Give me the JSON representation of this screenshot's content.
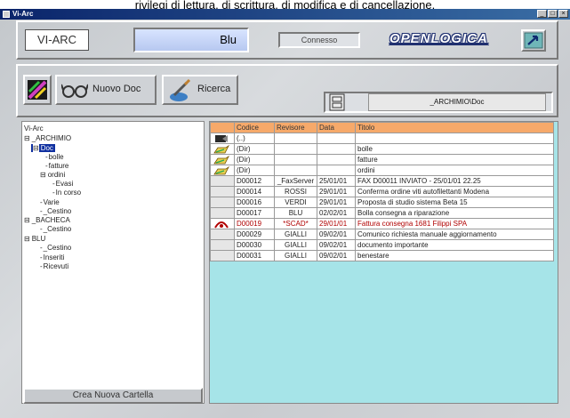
{
  "caption": "rivilegi di lettura, di scrittura, di modifica e di cancellazione.",
  "window": {
    "title": "Vi-Arc",
    "controls": [
      "_",
      "□",
      "×"
    ]
  },
  "header": {
    "archive_label": "VI-ARC",
    "user_label": "Blu",
    "status_label": "Connesso",
    "brand": "OPENLOGICA",
    "exit_icon": "exit-arrow-icon"
  },
  "toolbar": {
    "view_icon": "colors-icon",
    "new_doc_label": "Nuovo Doc",
    "new_doc_icon": "glasses-icon",
    "search_label": "Ricerca",
    "search_icon": "brush-icon",
    "archive_path_icon": "cabinet-icon",
    "archive_path": "_ARCHIMIO\\Doc"
  },
  "tree": {
    "root": "Vi-Arc",
    "nodes": [
      {
        "label": "_ARCHIMIO",
        "expander": "⊟"
      },
      {
        "label": "Doc",
        "expander": "⊟",
        "selected": true
      },
      {
        "label": "bolle",
        "expander": ""
      },
      {
        "label": "fatture",
        "expander": ""
      },
      {
        "label": "ordini",
        "expander": "⊟"
      },
      {
        "label": "Evasi",
        "expander": ""
      },
      {
        "label": "In corso",
        "expander": ""
      },
      {
        "label": "Varie",
        "expander": ""
      },
      {
        "label": "_Cestino",
        "expander": ""
      },
      {
        "label": "_BACHECA",
        "expander": "⊟"
      },
      {
        "label": "_Cestino",
        "expander": ""
      },
      {
        "label": "BLU",
        "expander": "⊟"
      },
      {
        "label": "_Cestino",
        "expander": ""
      },
      {
        "label": "Inseriti",
        "expander": ""
      },
      {
        "label": "Ricevuti",
        "expander": ""
      }
    ],
    "new_folder_label": "Crea Nuova Cartella"
  },
  "table": {
    "headers": [
      "",
      "Codice",
      "Revisore",
      "Data",
      "Titolo"
    ],
    "rows": [
      {
        "icon": "folder-up-icon",
        "codice": "(..)",
        "revisore": "",
        "data": "",
        "titolo": "",
        "flag": "normal"
      },
      {
        "icon": "folder-icon",
        "codice": "(Dir)",
        "revisore": "",
        "data": "",
        "titolo": "bolle",
        "flag": "normal"
      },
      {
        "icon": "folder-icon",
        "codice": "(Dir)",
        "revisore": "",
        "data": "",
        "titolo": "fatture",
        "flag": "normal"
      },
      {
        "icon": "folder-icon",
        "codice": "(Dir)",
        "revisore": "",
        "data": "",
        "titolo": "ordini",
        "flag": "normal"
      },
      {
        "icon": "",
        "codice": "D00012",
        "revisore": "_FaxServer",
        "data": "25/01/01",
        "titolo": "FAX D00011 INVIATO - 25/01/01 22.25",
        "flag": "normal"
      },
      {
        "icon": "",
        "codice": "D00014",
        "revisore": "ROSSI",
        "data": "29/01/01",
        "titolo": "Conferma ordine viti autofilettanti Modena",
        "flag": "normal"
      },
      {
        "icon": "",
        "codice": "D00016",
        "revisore": "VERDI",
        "data": "29/01/01",
        "titolo": "Proposta di studio sistema Beta 15",
        "flag": "normal"
      },
      {
        "icon": "",
        "codice": "D00017",
        "revisore": "BLU",
        "data": "02/02/01",
        "titolo": "Bolla consegna a riparazione",
        "flag": "normal"
      },
      {
        "icon": "expired-icon",
        "codice": "D00019",
        "revisore": "*SCAD*",
        "data": "29/01/01",
        "titolo": "Fattura consegna 1681 Filippi SPA",
        "flag": "expired"
      },
      {
        "icon": "",
        "codice": "D00029",
        "revisore": "GIALLI",
        "data": "09/02/01",
        "titolo": "Comunico richiesta manuale aggiornamento",
        "flag": "normal"
      },
      {
        "icon": "",
        "codice": "D00030",
        "revisore": "GIALLI",
        "data": "09/02/01",
        "titolo": "documento importante",
        "flag": "normal"
      },
      {
        "icon": "",
        "codice": "D00031",
        "revisore": "GIALLI",
        "data": "09/02/01",
        "titolo": "benestare",
        "flag": "normal"
      }
    ]
  },
  "colors": {
    "header_row": "#f6a96a",
    "grid_bg": "#a6e4e8",
    "selection": "#1030a0",
    "expired_text": "#b00000"
  }
}
